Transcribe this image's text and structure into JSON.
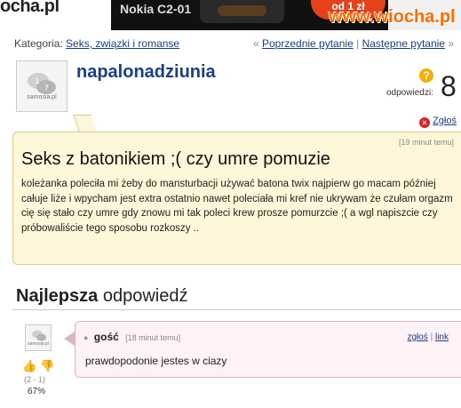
{
  "banner": {
    "watermark_left": "ocha.pl",
    "watermark_right": "www.wiocha.pl",
    "ad_text": "Nokia C2-01",
    "ad_promo": "od 1 zł"
  },
  "breadcrumb": {
    "category_label": "Kategoria:",
    "category_link": "Seks, związki i romanse",
    "prev_prefix": "«",
    "prev_link": "Poprzednie pytanie",
    "separator": "|",
    "next_link": "Następne pytanie",
    "next_suffix": "»"
  },
  "question": {
    "author": "napalonadziunia",
    "avatar_label": "samosia.pl",
    "answers_label": "odpowiedzi:",
    "answers_count": "8",
    "report_label": "Zgłoś",
    "time": "[19 minut temu]",
    "title": "Seks z batonikiem ;( czy umre pomuzie",
    "body": "koleżanka poleciła mi żeby do mansturbacji używać batona twix najpierw go macam później całuje liże i wpycham jest extra ostatnio nawet poleciała mi kref nie ukrywam że czułam orgazm cię się stało czy umre gdy znowu mi tak poleci krew prosze pomurzcie ;( a wgl napiszcie czy próbowaliście tego sposobu rozkoszy .."
  },
  "best_answer": {
    "heading_bold": "Najlepsza",
    "heading_rest": "odpowiedź",
    "author": "gość",
    "time": "[18 minut temu]",
    "report_link": "zgłoś",
    "link_sep": "|",
    "link": "link",
    "text": "prawdopodonie jestes w ciazy",
    "votes": "(2 - 1)",
    "percent": "67%",
    "avatar_label": "samosia.pl"
  }
}
